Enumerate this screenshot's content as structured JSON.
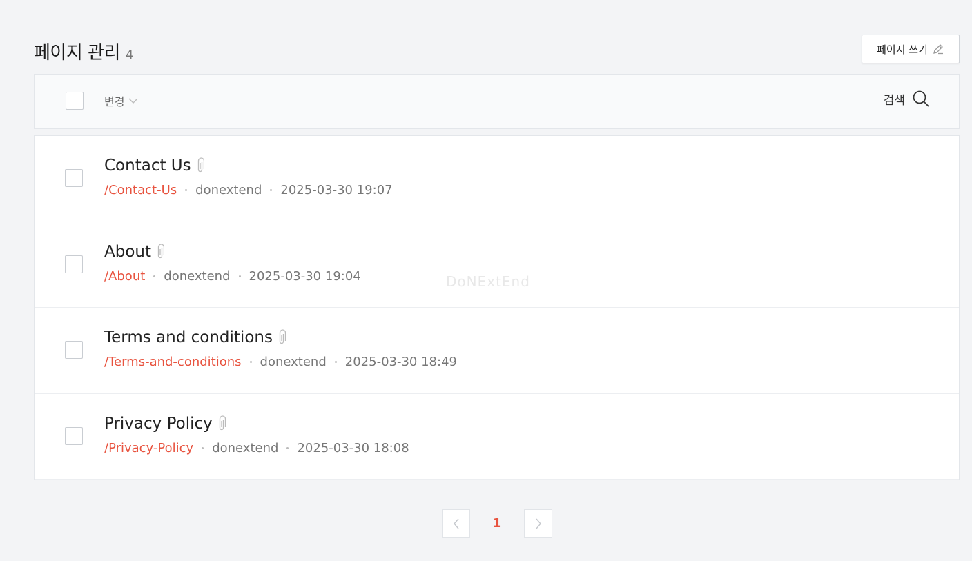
{
  "header": {
    "title": "페이지 관리",
    "count": "4",
    "write_button_label": "페이지 쓰기"
  },
  "toolbar": {
    "change_label": "변경",
    "search_label": "검색"
  },
  "rows": [
    {
      "title": "Contact Us",
      "slug": "/Contact-Us",
      "author": "donextend",
      "date": "2025-03-30 19:07"
    },
    {
      "title": "About",
      "slug": "/About",
      "author": "donextend",
      "date": "2025-03-30 19:04"
    },
    {
      "title": "Terms and conditions",
      "slug": "/Terms-and-conditions",
      "author": "donextend",
      "date": "2025-03-30 18:49"
    },
    {
      "title": "Privacy Policy",
      "slug": "/Privacy-Policy",
      "author": "donextend",
      "date": "2025-03-30 18:08"
    }
  ],
  "watermark": "DoNExtEnd",
  "pagination": {
    "current_page": "1"
  },
  "colors": {
    "accent": "#e8533f",
    "background": "#f3f4f6"
  }
}
